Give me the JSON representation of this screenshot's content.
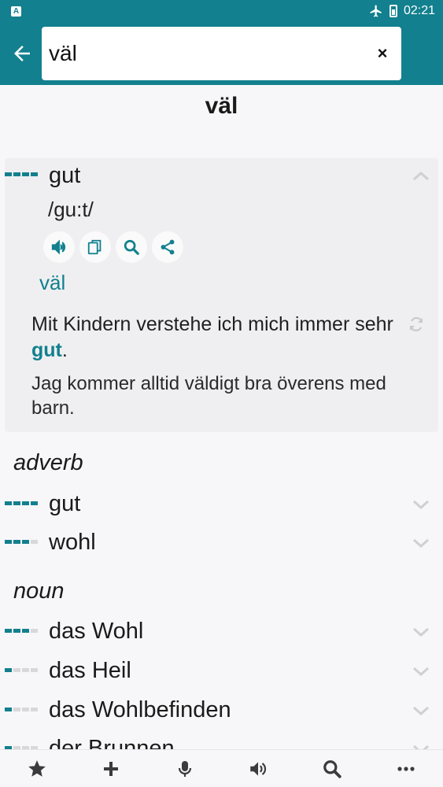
{
  "status": {
    "app_badge": "A",
    "time": "02:21"
  },
  "search": {
    "value": "väl",
    "clear_label": "×"
  },
  "headword": "väl",
  "expanded_entry": {
    "word": "gut",
    "frequency": 4,
    "pronunciation": "/gu:t/",
    "translation": "väl",
    "example_before": "Mit Kindern verstehe ich mich immer sehr ",
    "example_highlight": "gut",
    "example_after": ".",
    "example_translation": "Jag kommer alltid väldigt bra överens med barn."
  },
  "sections": [
    {
      "pos": "adverb",
      "entries": [
        {
          "word": "gut",
          "frequency": 4
        },
        {
          "word": "wohl",
          "frequency": 3
        }
      ]
    },
    {
      "pos": "noun",
      "entries": [
        {
          "word": "das Wohl",
          "frequency": 3
        },
        {
          "word": "das Heil",
          "frequency": 1
        },
        {
          "word": "das Wohlbefinden",
          "frequency": 1
        },
        {
          "word": "der Brunnen",
          "frequency": 1
        }
      ]
    }
  ],
  "colors": {
    "accent": "#12808e",
    "background": "#f7f7f9"
  },
  "icons": [
    "back-arrow-icon",
    "speaker-icon",
    "copy-icon",
    "search-icon",
    "share-icon",
    "refresh-icon",
    "chevron-up-icon",
    "chevron-down-icon",
    "star-icon",
    "plus-icon",
    "microphone-icon",
    "more-icon"
  ]
}
